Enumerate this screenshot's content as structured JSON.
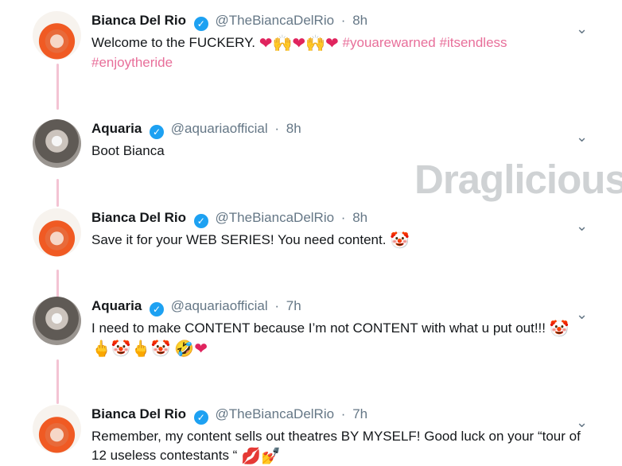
{
  "watermark": "Draglicious",
  "tweets": [
    {
      "author": "Bianca Del Rio",
      "handle": "@TheBiancaDelRio",
      "time": "8h",
      "parts": [
        "Welcome to the FUCKERY. ",
        "❤",
        "🙌",
        "❤",
        "🙌",
        "❤",
        " ",
        "#youarewarned",
        " ",
        "#itsendless",
        " ",
        "#enjoytheride"
      ]
    },
    {
      "author": "Aquaria",
      "handle": "@aquariaofficial",
      "time": "8h",
      "parts": [
        "Boot Bianca"
      ]
    },
    {
      "author": "Bianca Del Rio",
      "handle": "@TheBiancaDelRio",
      "time": "8h",
      "parts": [
        "Save it for your WEB SERIES! You need content. ",
        "🤡"
      ]
    },
    {
      "author": "Aquaria",
      "handle": "@aquariaofficial",
      "time": "7h",
      "parts": [
        "I need to make CONTENT because I’m not CONTENT with what u put out!!! ",
        "🤡",
        "🖕",
        "🤡",
        "🖕",
        "🤡",
        " ",
        "🤣",
        "❤"
      ]
    },
    {
      "author": "Bianca Del Rio",
      "handle": "@TheBiancaDelRio",
      "time": "7h",
      "parts": [
        "Remember, my content sells out theatres BY MYSELF! Good luck on your “tour of 12 useless contestants “ ",
        "💋",
        "💅"
      ]
    }
  ]
}
